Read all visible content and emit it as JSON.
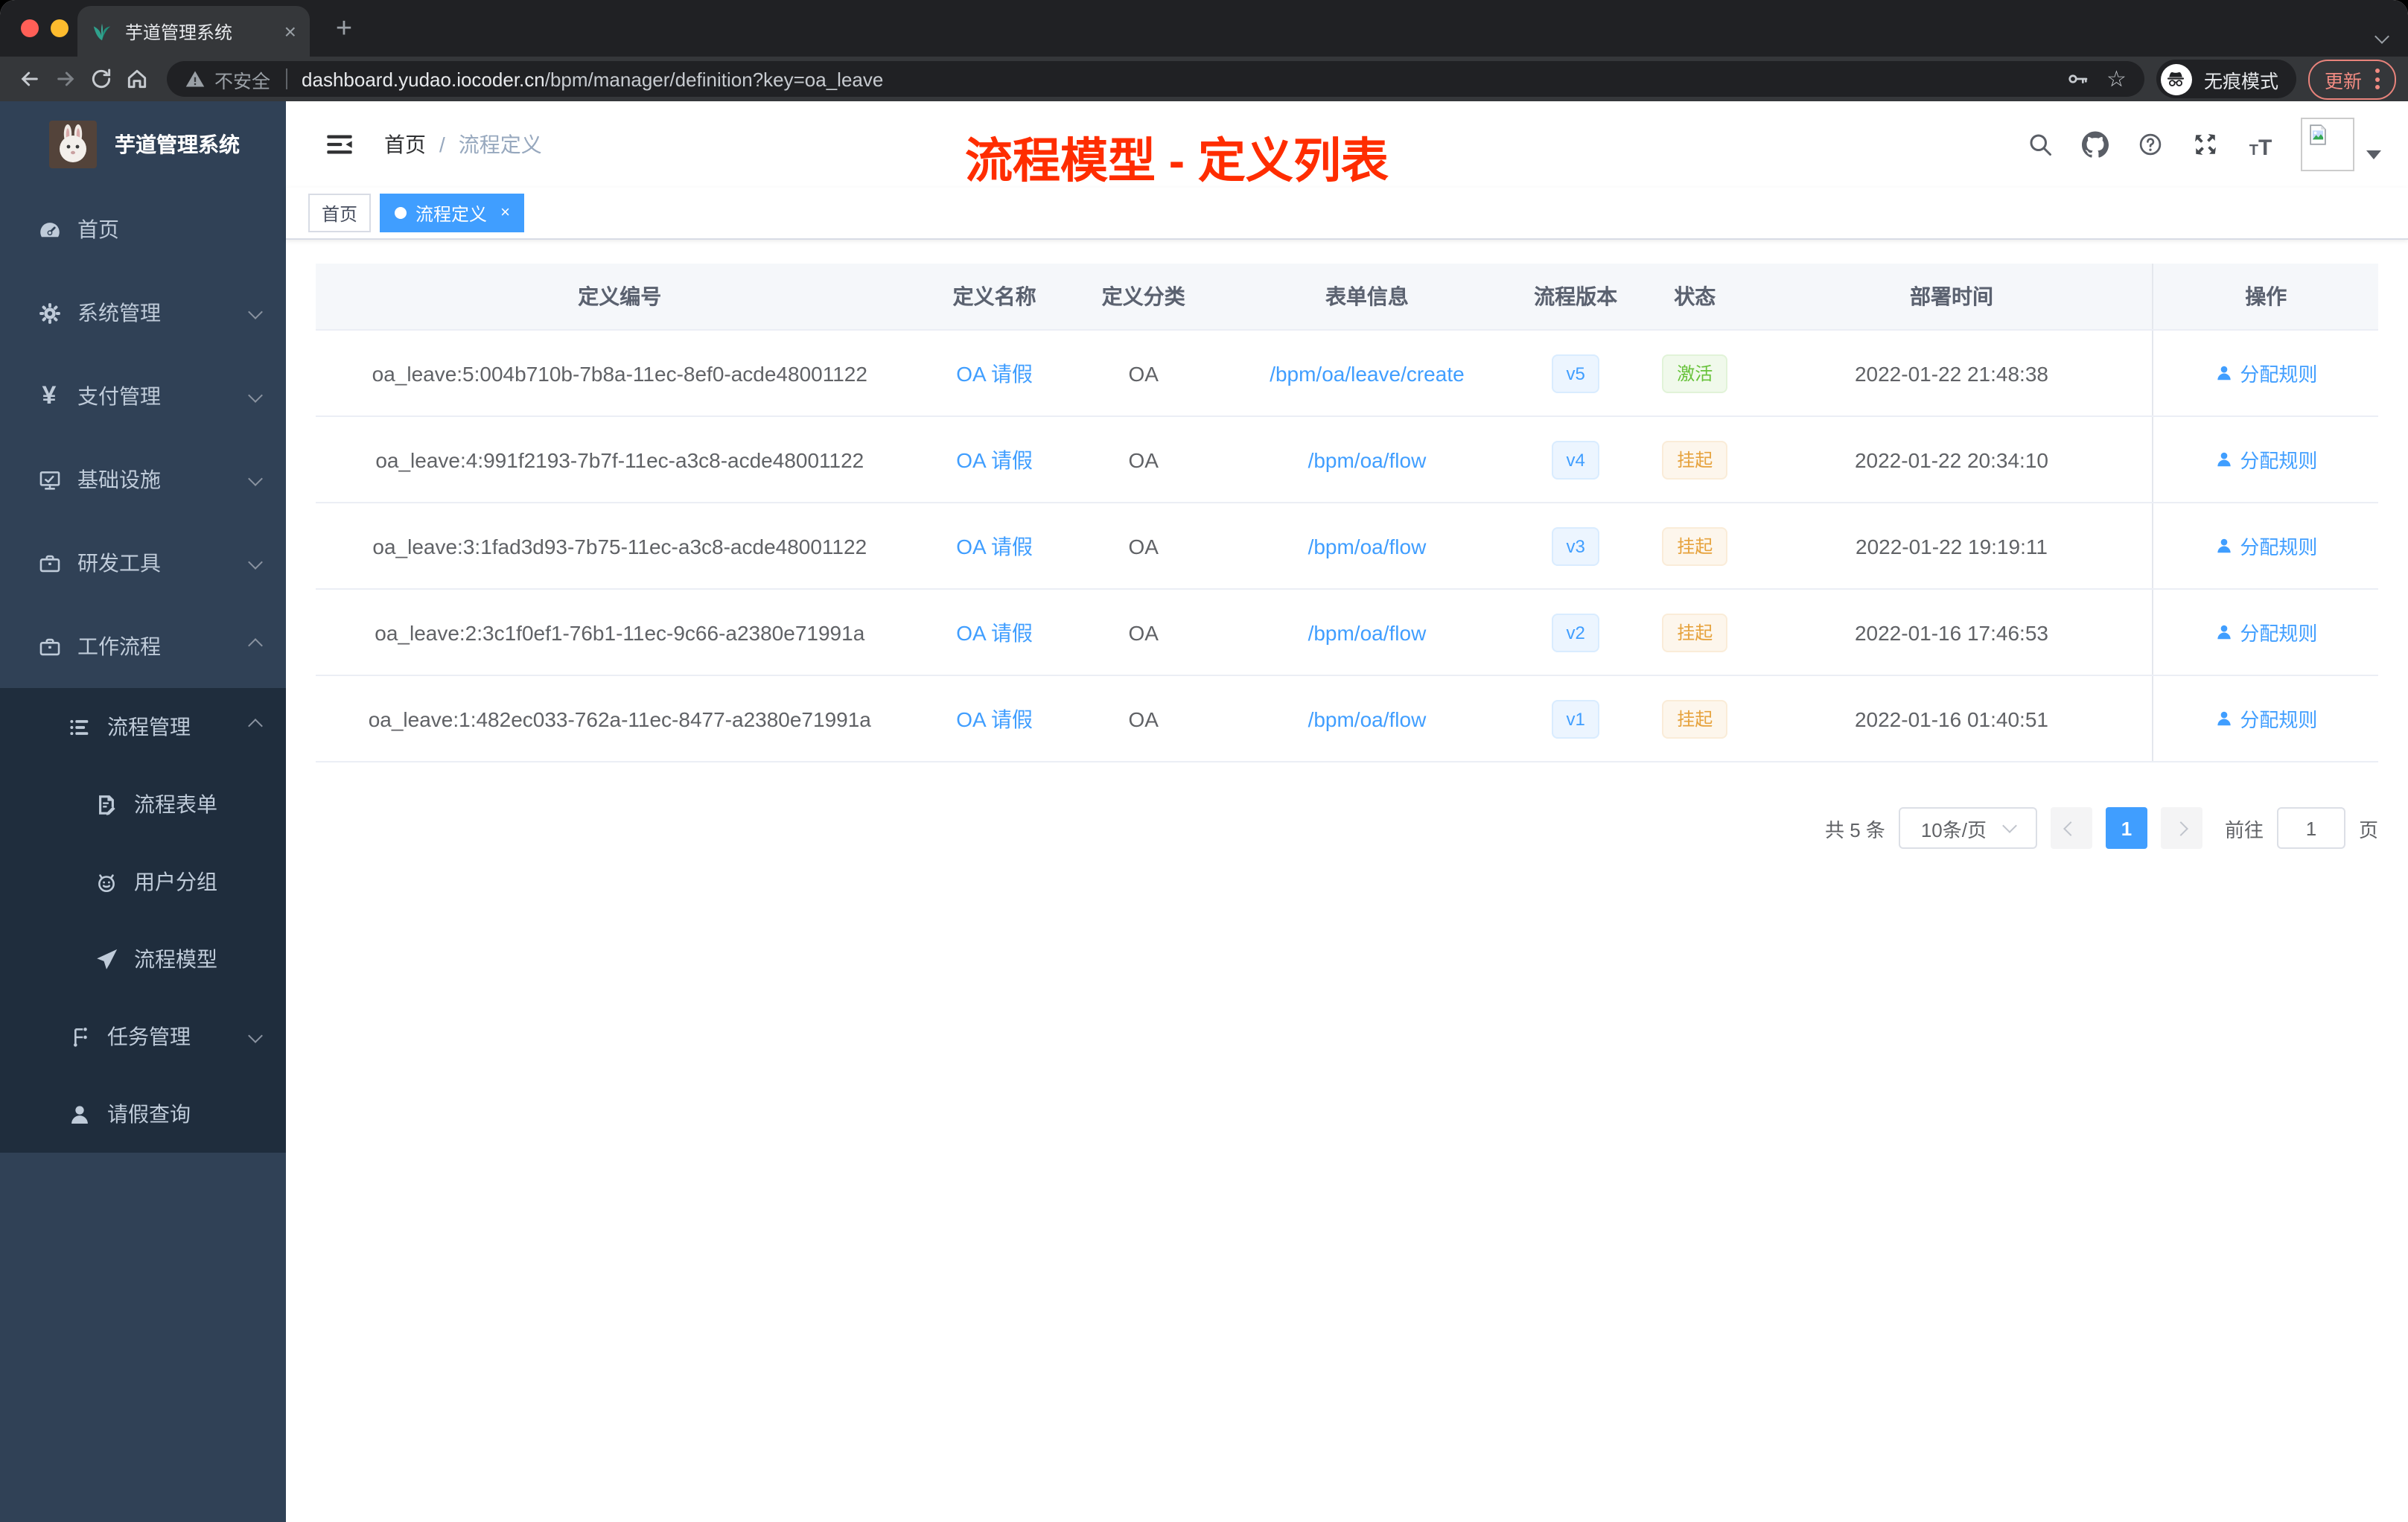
{
  "browser": {
    "tab_title": "芋道管理系统",
    "tab_close": "×",
    "new_tab": "+",
    "address": {
      "security_label": "不安全",
      "url_domain": "dashboard.yudao.iocoder.cn",
      "url_path": "/bpm/manager/definition?key=oa_leave"
    },
    "incognito_label": "无痕模式",
    "update_label": "更新"
  },
  "sidebar": {
    "logo_title": "芋道管理系统",
    "items": [
      {
        "id": "home",
        "label": "首页",
        "icon": "dashboard-icon",
        "level": 1
      },
      {
        "id": "system-management",
        "label": "系统管理",
        "icon": "gear-icon",
        "level": 1,
        "chevron": "down"
      },
      {
        "id": "payment-management",
        "label": "支付管理",
        "icon": "yen-icon",
        "level": 1,
        "chevron": "down"
      },
      {
        "id": "infrastructure",
        "label": "基础设施",
        "icon": "monitor-icon",
        "level": 1,
        "chevron": "down"
      },
      {
        "id": "dev-tools",
        "label": "研发工具",
        "icon": "briefcase-icon",
        "level": 1,
        "chevron": "down"
      },
      {
        "id": "workflow",
        "label": "工作流程",
        "icon": "briefcase-icon",
        "level": 1,
        "chevron": "up"
      },
      {
        "id": "process-management",
        "label": "流程管理",
        "icon": "list-icon",
        "level": 2,
        "chevron": "up",
        "sub": true
      },
      {
        "id": "process-form",
        "label": "流程表单",
        "icon": "form-icon",
        "level": 3,
        "sub": true
      },
      {
        "id": "user-group",
        "label": "用户分组",
        "icon": "people-icon",
        "level": 3,
        "sub": true
      },
      {
        "id": "process-model",
        "label": "流程模型",
        "icon": "send-icon",
        "level": 3,
        "sub": true
      },
      {
        "id": "task-management",
        "label": "任务管理",
        "icon": "tree-icon",
        "level": 2,
        "chevron": "down",
        "sub": true
      },
      {
        "id": "leave-query",
        "label": "请假查询",
        "icon": "user-icon",
        "level": 2,
        "sub": true
      }
    ]
  },
  "header": {
    "breadcrumb_home": "首页",
    "breadcrumb_separator": "/",
    "breadcrumb_current": "流程定义",
    "annotation": "流程模型 - 定义列表",
    "annotation_color": "#ff2d00"
  },
  "tags": {
    "home": "首页",
    "current": "流程定义",
    "close": "×"
  },
  "table": {
    "columns": [
      "定义编号",
      "定义名称",
      "定义分类",
      "表单信息",
      "流程版本",
      "状态",
      "部署时间",
      "操作"
    ],
    "rows": [
      {
        "id": "oa_leave:5:004b710b-7b8a-11ec-8ef0-acde48001122",
        "name": "OA 请假",
        "category": "OA",
        "form": "/bpm/oa/leave/create",
        "version": "v5",
        "status": "激活",
        "status_type": "success",
        "deploy_time": "2022-01-22 21:48:38",
        "action": "分配规则"
      },
      {
        "id": "oa_leave:4:991f2193-7b7f-11ec-a3c8-acde48001122",
        "name": "OA 请假",
        "category": "OA",
        "form": "/bpm/oa/flow",
        "version": "v4",
        "status": "挂起",
        "status_type": "warning",
        "deploy_time": "2022-01-22 20:34:10",
        "action": "分配规则"
      },
      {
        "id": "oa_leave:3:1fad3d93-7b75-11ec-a3c8-acde48001122",
        "name": "OA 请假",
        "category": "OA",
        "form": "/bpm/oa/flow",
        "version": "v3",
        "status": "挂起",
        "status_type": "warning",
        "deploy_time": "2022-01-22 19:19:11",
        "action": "分配规则"
      },
      {
        "id": "oa_leave:2:3c1f0ef1-76b1-11ec-9c66-a2380e71991a",
        "name": "OA 请假",
        "category": "OA",
        "form": "/bpm/oa/flow",
        "version": "v2",
        "status": "挂起",
        "status_type": "warning",
        "deploy_time": "2022-01-16 17:46:53",
        "action": "分配规则"
      },
      {
        "id": "oa_leave:1:482ec033-762a-11ec-8477-a2380e71991a",
        "name": "OA 请假",
        "category": "OA",
        "form": "/bpm/oa/flow",
        "version": "v1",
        "status": "挂起",
        "status_type": "warning",
        "deploy_time": "2022-01-16 01:40:51",
        "action": "分配规则"
      }
    ]
  },
  "pagination": {
    "total": "共 5 条",
    "page_size": "10条/页",
    "current": "1",
    "goto_label": "前往",
    "goto_value": "1",
    "page_label": "页"
  },
  "colors": {
    "annotation_red": "#ff2d00",
    "accent_blue": "#409eff",
    "status_active_text": "#67c23a",
    "status_active_bg": "#f0f9eb",
    "status_suspended_text": "#e6a23c",
    "status_suspended_bg": "#fdf6ec",
    "version_badge_text": "#409eff",
    "version_badge_bg": "#ecf5ff",
    "sidebar_bg": "#304156",
    "submenu_bg": "#1f2d3d",
    "update_button": "#f28b82"
  }
}
